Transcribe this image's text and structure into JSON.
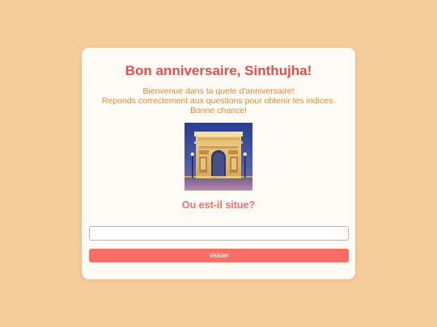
{
  "header": {
    "title": "Bon anniversaire, Sinthujha!"
  },
  "intro": {
    "lines": [
      "Bienvenue dans ta quete d'anniversaire!",
      "Reponds correctement aux questions pour obtenir tes indices.",
      "Bonne chance!"
    ]
  },
  "question": {
    "text": "Ou est-il situe?"
  },
  "answer": {
    "value": "",
    "placeholder": ""
  },
  "submit": {
    "label": "Valider"
  },
  "colors": {
    "background": "#f6cb9a",
    "card": "#fefaf4",
    "title": "#e04e50",
    "intro": "#ea8a2c",
    "question": "#ef7070",
    "button": "#f86d66"
  }
}
